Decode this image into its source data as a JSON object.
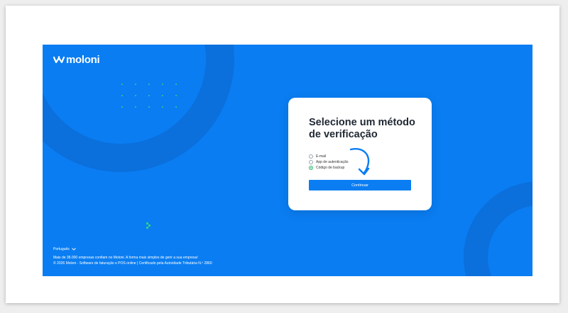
{
  "brand": {
    "name": "moloni"
  },
  "colors": {
    "primary": "#0a7df2",
    "accent": "#27b36b",
    "title": "#1f2732"
  },
  "card": {
    "title_line1": "Selecione um método",
    "title_line2": "de verificação",
    "options": [
      {
        "label": "E-mail",
        "checked": false
      },
      {
        "label": "App de autenticação",
        "checked": false
      },
      {
        "label": "Código de backup",
        "checked": true
      }
    ],
    "continue_label": "Continuar"
  },
  "footer": {
    "language": "Português",
    "line1": "Mais de 38.000 empresas confiam no Moloni. A forma mais simples de gerir a sua empresa!",
    "line2": "© 2026 Moloni - Software de faturação e POS online | Certificado pela Autoridade Tributária N.º 2860"
  },
  "icons": [
    "moloni-logo-icon",
    "chevron-down-icon",
    "curved-arrow-icon"
  ]
}
